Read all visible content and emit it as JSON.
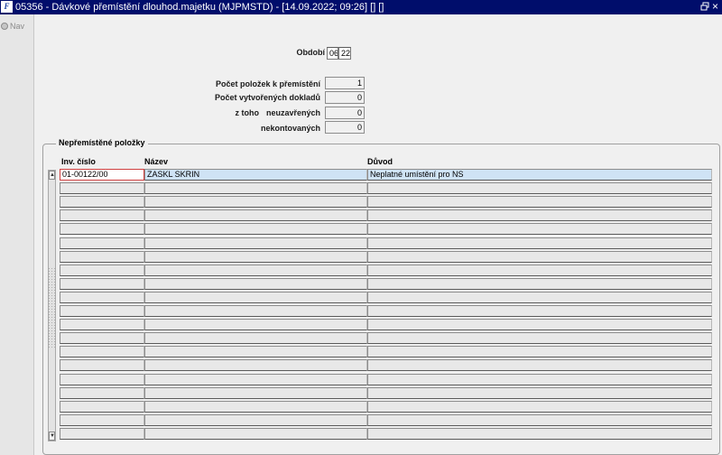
{
  "window": {
    "logo": "F",
    "title": "05356 - Dávkové přemístění dlouhod.majetku (MJPMSTD) - [14.09.2022; 09:26] [] []",
    "restore_icon": "restore-icon",
    "close_glyph": "×"
  },
  "nav": {
    "label": "Nav",
    "icon": "nav-icon"
  },
  "form": {
    "obdobi_label": "Období",
    "obdobi_month": "06",
    "obdobi_year": "22",
    "pocet_polozek_label": "Počet položek k přemístění",
    "pocet_polozek_value": "1",
    "pocet_dokladu_label": "Počet vytvořených dokladů",
    "pocet_dokladu_value": "0",
    "z_toho_label": "z toho",
    "neuzavrenych_label": "neuzavřených",
    "neuzavrenych_value": "0",
    "nekontovanych_label": "nekontovaných",
    "nekontovanych_value": "0"
  },
  "group": {
    "title": "Nepřemístěné položky",
    "columns": [
      "Inv. číslo",
      "Název",
      "Důvod"
    ],
    "rows": [
      [
        "01-00122/00",
        "ZASKL SKRIN",
        "Neplatné umístění pro NS"
      ],
      [
        "",
        "",
        ""
      ],
      [
        "",
        "",
        ""
      ],
      [
        "",
        "",
        ""
      ],
      [
        "",
        "",
        ""
      ],
      [
        "",
        "",
        ""
      ],
      [
        "",
        "",
        ""
      ],
      [
        "",
        "",
        ""
      ],
      [
        "",
        "",
        ""
      ],
      [
        "",
        "",
        ""
      ],
      [
        "",
        "",
        ""
      ],
      [
        "",
        "",
        ""
      ],
      [
        "",
        "",
        ""
      ],
      [
        "",
        "",
        ""
      ],
      [
        "",
        "",
        ""
      ],
      [
        "",
        "",
        ""
      ],
      [
        "",
        "",
        ""
      ],
      [
        "",
        "",
        ""
      ],
      [
        "",
        "",
        ""
      ],
      [
        "",
        "",
        ""
      ]
    ]
  },
  "colors": {
    "titlebar": "#000d6b",
    "selected_row": "#cfe3f5",
    "focus_border": "#d04040"
  }
}
